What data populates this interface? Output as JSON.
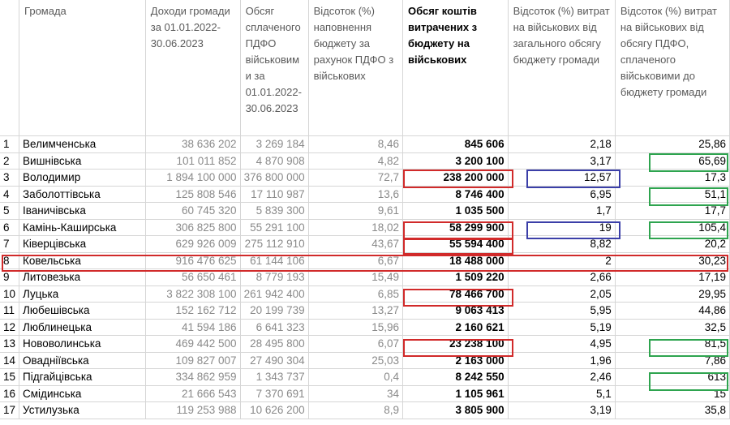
{
  "headers": [
    "",
    "Громада",
    "Доходи громади за 01.01.2022-30.06.2023",
    "Обсяг сплаченого ПДФО військовими за 01.01.2022-30.06.2023",
    "Відсоток (%) наповнення бюджету за рахунок ПДФО з військових",
    "Обсяг коштів витрачених з бюджету на військових",
    "Відсоток (%) витрат на військових від загального обсягу бюджету громади",
    "Відсоток (%) витрат на військових від обсягу ПДФО, сплаченого військовими до бюджету громади"
  ],
  "rows": [
    [
      "1",
      "Велимченська",
      "38 636 202",
      "3 269 184",
      "8,46",
      "845 606",
      "2,18",
      "25,86"
    ],
    [
      "2",
      "Вишнівська",
      "101 011 852",
      "4 870 908",
      "4,82",
      "3 200 100",
      "3,17",
      "65,69"
    ],
    [
      "3",
      "Володимир",
      "1 894 100 000",
      "376 800 000",
      "72,7",
      "238 200 000",
      "12,57",
      "17,3"
    ],
    [
      "4",
      "Заболоттівська",
      "125 808 546",
      "17 110 987",
      "13,6",
      "8 746 400",
      "6,95",
      "51,1"
    ],
    [
      "5",
      "Іваничівська",
      "60 745 320",
      "5 839 300",
      "9,61",
      "1 035 500",
      "1,7",
      "17,7"
    ],
    [
      "6",
      "Камінь-Каширська",
      "306 825 800",
      "55 291 100",
      "18,02",
      "58 299 900",
      "19",
      "105,4"
    ],
    [
      "7",
      "Ківерцівська",
      "629 926 009",
      "275 112 910",
      "43,67",
      "55 594 400",
      "8,82",
      "20,2"
    ],
    [
      "8",
      "Ковельська",
      "916 476 625",
      "61 144 106",
      "6,67",
      "18 488 000",
      "2",
      "30,23"
    ],
    [
      "9",
      "Литовезька",
      "56 650 461",
      "8 779 193",
      "15,49",
      "1 509 220",
      "2,66",
      "17,19"
    ],
    [
      "10",
      "Луцька",
      "3 822 308 100",
      "261 942 400",
      "6,85",
      "78 466 700",
      "2,05",
      "29,95"
    ],
    [
      "11",
      "Любешівська",
      "152 162 712",
      "20 199 739",
      "13,27",
      "9 063 413",
      "5,95",
      "44,86"
    ],
    [
      "12",
      "Люблинецька",
      "41 594 186",
      "6 641 323",
      "15,96",
      "2 160 621",
      "5,19",
      "32,5"
    ],
    [
      "13",
      "Нововолинська",
      "469 442 500",
      "28 495 800",
      "6,07",
      "23 238 100",
      "4,95",
      "81,5"
    ],
    [
      "14",
      "Овадніївська",
      "109 827 007",
      "27 490 304",
      "25,03",
      "2 163 000",
      "1,96",
      "7,86"
    ],
    [
      "15",
      "Підгайцівська",
      "334 862 959",
      "1 343 737",
      "0,4",
      "8 242 550",
      "2,46",
      "613"
    ],
    [
      "16",
      "Смідинська",
      "21 666 543",
      "7 370 691",
      "34",
      "1 105 961",
      "5,1",
      "15"
    ],
    [
      "17",
      "Устилузька",
      "119 253 988",
      "10 626 200",
      "8,9",
      "3 805 900",
      "3,19",
      "35,8"
    ]
  ],
  "highlight_colors": {
    "red": "#d12a2a",
    "blue": "#3b3fa8",
    "green": "#2ea44f"
  }
}
